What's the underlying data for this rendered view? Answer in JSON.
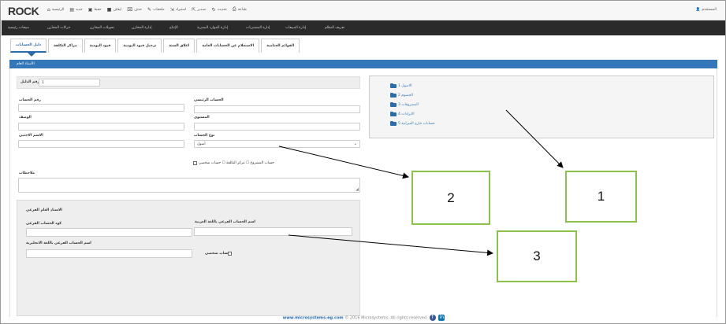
{
  "topbar": {
    "logo": "ROCK",
    "nav": [
      {
        "label": "الرئيسية",
        "icon": "home-icon",
        "glyph": "⌂"
      },
      {
        "label": "جديد",
        "icon": "file-icon",
        "glyph": "▤"
      },
      {
        "label": "حفظ",
        "icon": "save-icon",
        "glyph": "▣"
      },
      {
        "label": "ايقاف",
        "icon": "stop-icon",
        "glyph": "■"
      },
      {
        "label": "حذف",
        "icon": "trash-icon",
        "glyph": "⌧"
      },
      {
        "label": "ملحقات",
        "icon": "attachment-icon",
        "glyph": "✎"
      },
      {
        "label": "استيراد",
        "icon": "import-icon",
        "glyph": "⇲"
      },
      {
        "label": "تصدير",
        "icon": "export-icon",
        "glyph": "⇱"
      },
      {
        "label": "تحديث",
        "icon": "refresh-icon",
        "glyph": "↻"
      },
      {
        "label": "طباعة",
        "icon": "print-icon",
        "glyph": "⎙"
      }
    ],
    "user_label": "المستخدم"
  },
  "menubar": {
    "items": [
      "مبيعات رئيسية",
      "حركات المخازن",
      "تحويلات المخازن",
      "إدارة المخازن",
      "الإنتاج",
      "إدارة الموارد البشرية",
      "إدارة المشتريات",
      "إدارة المبيعات",
      "تعريف النظام"
    ]
  },
  "tabs": [
    {
      "label": "دليل الحسابات",
      "active": true
    },
    {
      "label": "مراكز التكلفة",
      "active": false
    },
    {
      "label": "قيود اليومية",
      "active": false
    },
    {
      "label": "ترحيل قيود اليومية",
      "active": false
    },
    {
      "label": "اغلاق السنة",
      "active": false
    },
    {
      "label": "الاستعلام عن الحسابات العامة",
      "active": false
    },
    {
      "label": "القوائم الختامية",
      "active": false
    }
  ],
  "panel": {
    "title": "الأستاذ العام"
  },
  "form": {
    "level_label": "رقم الدليل",
    "level_value": "1",
    "account_no_label": "رقم الحساب",
    "main_account_label": "الحساب الرئيسي",
    "description_label": "الوصف",
    "level2_label": "المستوى",
    "foreign_name_label": "الاسم الاجنبي",
    "account_type_label": "نوع الحساب",
    "account_type_value": "أصول",
    "checkboxes_label": "حساب المشروع ☐ مركز التكلفة ☐ حساب شخصي",
    "notes_label": "ملاحظات"
  },
  "tree": [
    {
      "label": "الاصول 1"
    },
    {
      "label": "الخصوم 2"
    },
    {
      "label": "المصروفات 3"
    },
    {
      "label": "الايرادات 4"
    },
    {
      "label": "حسابات خارج الميزانية 5"
    }
  ],
  "subledger": {
    "title": "الاستاذ العام الفرعي",
    "code_label": "كود الحساب الفرعي",
    "arabic_name_label": "اسم الحساب الفرعي باللغة العربية",
    "english_name_label": "اسم الحساب الفرعي باللغة الانجليزية",
    "personal_label": "حساب شخصي"
  },
  "annotations": [
    {
      "label": "2"
    },
    {
      "label": "1"
    },
    {
      "label": "3"
    }
  ],
  "footer": {
    "site": "www.microsystems-eg.com",
    "copyright": "© 2016 Microsystems. All rights reserved",
    "social": [
      "facebook-icon",
      "linkedin-icon"
    ]
  },
  "colors": {
    "accent": "#3477b9",
    "annotation_border": "#8bc34a",
    "menubar_bg": "#2a2a2a"
  }
}
